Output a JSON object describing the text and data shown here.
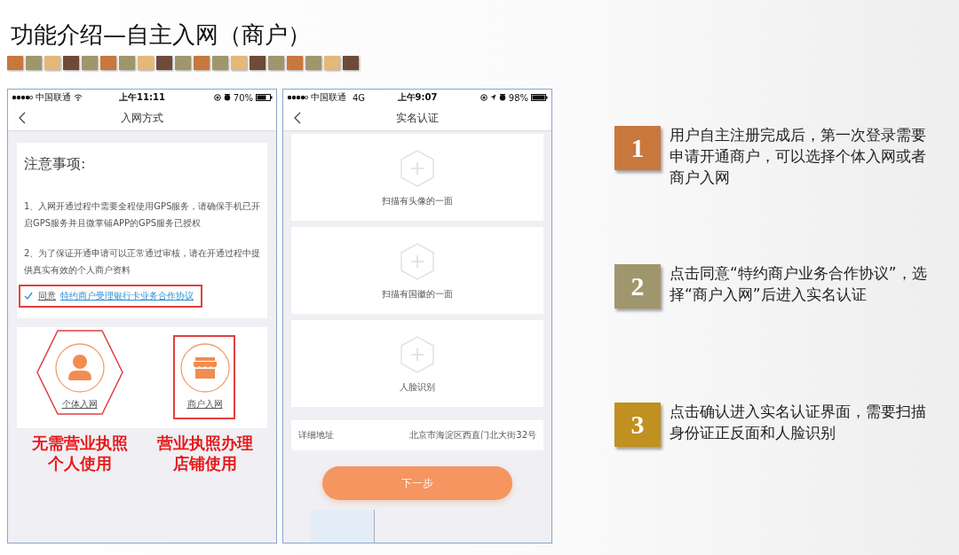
{
  "title": "功能介绍—自主入网（商户）",
  "phone_left": {
    "status_bar": {
      "carrier": "中国联通",
      "time": "上午11:11",
      "battery": "70%"
    },
    "nav_title": "入网方式",
    "notice": {
      "heading": "注意事项:",
      "items": [
        "1、入网开通过程中需要全程使用GPS服务，请确保手机已开启GPS服务并且微掌铺APP的GPS服务已授权",
        "2、为了保证开通申请可以正常通过审核，请在开通过程中提供真实有效的个人商户资料"
      ],
      "agreement": {
        "checked": true,
        "highlighted": true,
        "prefix": "同意",
        "link": "特约商户受理银行卡业务合作协议"
      }
    },
    "options": [
      {
        "kind": "person",
        "frame": {
          "kind": "hexagon"
        },
        "label": "个体入网",
        "note": [
          "无需营业执照",
          "个人使用"
        ]
      },
      {
        "kind": "shop",
        "frame": {
          "kind": "rect"
        },
        "label": "商户入网",
        "note": [
          "营业执照办理",
          "店铺使用"
        ]
      }
    ]
  },
  "phone_right": {
    "status_bar": {
      "carrier": "中国联通",
      "network": "4G",
      "time": "上午9:07",
      "battery": "98%"
    },
    "nav_title": "实名认证",
    "scan_cards": [
      "扫描有头像的一面",
      "扫描有国徽的一面",
      "人脸识别"
    ],
    "address": {
      "label": "详细地址",
      "value": "北京市海淀区西直门北大街32号"
    },
    "button": "下一步"
  },
  "steps": [
    {
      "number": "1",
      "color": "#c8783c",
      "text": "用户自主注册完成后，第一次登录需要申请开通商户，可以选择个体入网或者商户入网"
    },
    {
      "number": "2",
      "color": "#a0966e",
      "text": "点击同意“特约商户业务合作协议”，选择“商户入网”后进入实名认证"
    },
    {
      "number": "3",
      "color": "#c09020",
      "text": "点击确认进入实名认证界面，需要扫描身份证正反面和人脸识别"
    }
  ]
}
